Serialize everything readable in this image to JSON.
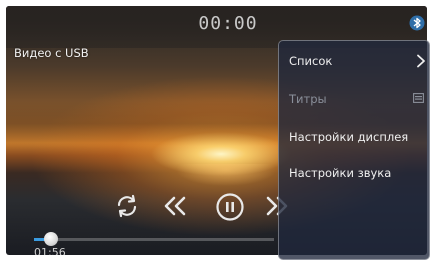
{
  "player": {
    "time_top": "00:00",
    "source_title": "Видео с USB",
    "elapsed": "01:56",
    "progress_fraction": 0.07,
    "accent_color": "#3a9be0"
  },
  "icons": {
    "bluetooth": "bluetooth-icon",
    "repeat": "repeat-icon",
    "previous": "previous-icon",
    "pause": "pause-icon",
    "next": "next-icon"
  },
  "menu": {
    "items": [
      {
        "label": "Список",
        "enabled": true,
        "icon": "chevron-right-icon"
      },
      {
        "label": "Титры",
        "enabled": false,
        "icon": "subtitles-icon"
      },
      {
        "label": "Настройки дисплея",
        "enabled": true
      },
      {
        "label": "Настройки звука",
        "enabled": true
      }
    ]
  }
}
